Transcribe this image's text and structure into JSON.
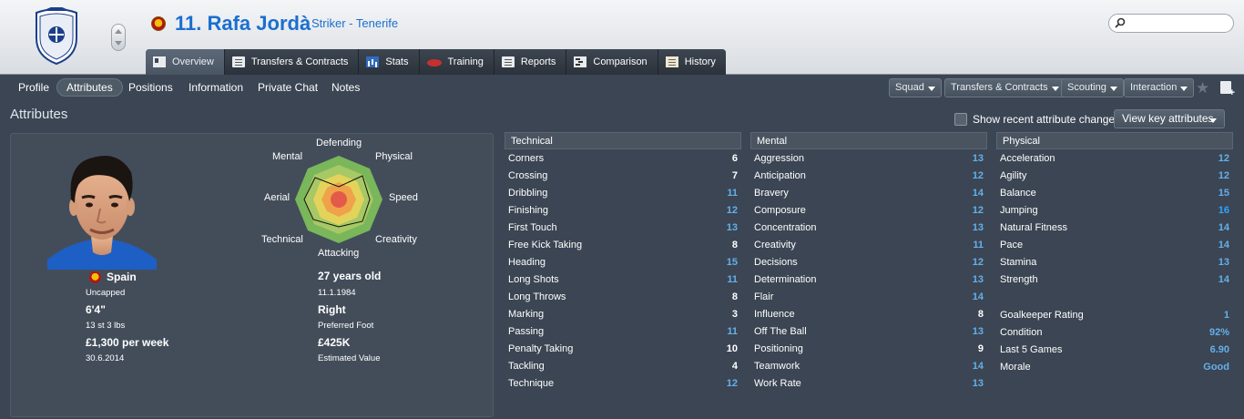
{
  "player": {
    "title": "11. Rafa Jordà",
    "subtitle": "Striker - Tenerife"
  },
  "search": {
    "placeholder": ""
  },
  "tabs": [
    {
      "label": "Overview",
      "icon": "overview-icon",
      "active": true
    },
    {
      "label": "Transfers & Contracts",
      "icon": "document-icon"
    },
    {
      "label": "Stats",
      "icon": "stats-icon"
    },
    {
      "label": "Training",
      "icon": "training-icon"
    },
    {
      "label": "Reports",
      "icon": "report-icon"
    },
    {
      "label": "Comparison",
      "icon": "comparison-icon"
    },
    {
      "label": "History",
      "icon": "history-icon"
    }
  ],
  "subnav": [
    "Profile",
    "Attributes",
    "Positions",
    "Information",
    "Private Chat",
    "Notes"
  ],
  "subnav_active": "Attributes",
  "dropdowns": [
    "Squad",
    "Transfers & Contracts",
    "Scouting",
    "Interaction"
  ],
  "section": {
    "title": "Attributes",
    "show_recent_label": "Show recent attribute changes",
    "view_key_label": "View key attributes"
  },
  "radar_labels": {
    "top": "Defending",
    "top_left": "Mental",
    "top_right": "Physical",
    "left": "Aerial",
    "right": "Speed",
    "bottom_left": "Technical",
    "bottom_right": "Creativity",
    "bottom": "Attacking"
  },
  "info": {
    "nationality": "Spain",
    "caps": "Uncapped",
    "height": "6'4\"",
    "weight": "13 st 3 lbs",
    "wage": "£1,300 per week",
    "contract_end": "30.6.2014",
    "age": "27 years old",
    "dob": "11.1.1984",
    "foot": "Right",
    "foot_label": "Preferred Foot",
    "value": "£425K",
    "value_label": "Estimated Value"
  },
  "colors": {
    "accent": "#1a6fd0",
    "value_blue": "#64b0ea",
    "background": "#3b4553"
  },
  "technical": {
    "header": "Technical",
    "rows": [
      {
        "name": "Corners",
        "value": "6",
        "tone": "white"
      },
      {
        "name": "Crossing",
        "value": "7",
        "tone": "white"
      },
      {
        "name": "Dribbling",
        "value": "11",
        "tone": "blue"
      },
      {
        "name": "Finishing",
        "value": "12",
        "tone": "blue"
      },
      {
        "name": "First Touch",
        "value": "13",
        "tone": "blue"
      },
      {
        "name": "Free Kick Taking",
        "value": "8",
        "tone": "white"
      },
      {
        "name": "Heading",
        "value": "15",
        "tone": "blue"
      },
      {
        "name": "Long Shots",
        "value": "11",
        "tone": "blue"
      },
      {
        "name": "Long Throws",
        "value": "8",
        "tone": "white"
      },
      {
        "name": "Marking",
        "value": "3",
        "tone": "white"
      },
      {
        "name": "Passing",
        "value": "11",
        "tone": "blue"
      },
      {
        "name": "Penalty Taking",
        "value": "10",
        "tone": "white"
      },
      {
        "name": "Tackling",
        "value": "4",
        "tone": "white"
      },
      {
        "name": "Technique",
        "value": "12",
        "tone": "blue"
      }
    ]
  },
  "mental": {
    "header": "Mental",
    "rows": [
      {
        "name": "Aggression",
        "value": "13",
        "tone": "blue"
      },
      {
        "name": "Anticipation",
        "value": "12",
        "tone": "blue"
      },
      {
        "name": "Bravery",
        "value": "14",
        "tone": "blue"
      },
      {
        "name": "Composure",
        "value": "12",
        "tone": "blue"
      },
      {
        "name": "Concentration",
        "value": "13",
        "tone": "blue"
      },
      {
        "name": "Creativity",
        "value": "11",
        "tone": "blue"
      },
      {
        "name": "Decisions",
        "value": "12",
        "tone": "blue"
      },
      {
        "name": "Determination",
        "value": "13",
        "tone": "blue"
      },
      {
        "name": "Flair",
        "value": "14",
        "tone": "blue"
      },
      {
        "name": "Influence",
        "value": "8",
        "tone": "white"
      },
      {
        "name": "Off The Ball",
        "value": "13",
        "tone": "blue"
      },
      {
        "name": "Positioning",
        "value": "9",
        "tone": "white"
      },
      {
        "name": "Teamwork",
        "value": "14",
        "tone": "blue"
      },
      {
        "name": "Work Rate",
        "value": "13",
        "tone": "blue"
      }
    ]
  },
  "physical": {
    "header": "Physical",
    "rows": [
      {
        "name": "Acceleration",
        "value": "12",
        "tone": "blue"
      },
      {
        "name": "Agility",
        "value": "12",
        "tone": "blue"
      },
      {
        "name": "Balance",
        "value": "15",
        "tone": "blue"
      },
      {
        "name": "Jumping",
        "value": "16",
        "tone": "bright"
      },
      {
        "name": "Natural Fitness",
        "value": "14",
        "tone": "blue"
      },
      {
        "name": "Pace",
        "value": "14",
        "tone": "blue"
      },
      {
        "name": "Stamina",
        "value": "13",
        "tone": "blue"
      },
      {
        "name": "Strength",
        "value": "14",
        "tone": "blue"
      }
    ],
    "extra": [
      {
        "name": "Goalkeeper Rating",
        "value": "1",
        "tone": "blue"
      },
      {
        "name": "Condition",
        "value": "92%",
        "tone": "blue"
      },
      {
        "name": "Last 5 Games",
        "value": "6.90",
        "tone": "blue"
      },
      {
        "name": "Morale",
        "value": "Good",
        "tone": "blue"
      }
    ]
  }
}
